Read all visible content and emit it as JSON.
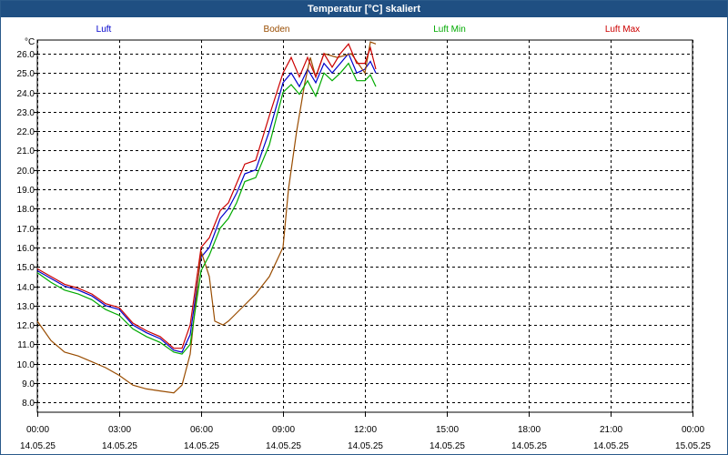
{
  "window": {
    "title": "Temperatur [°C] skaliert"
  },
  "chart_data": {
    "type": "line",
    "title": "Temperatur [°C] skaliert",
    "ylabel": "°C",
    "ylim": [
      8.0,
      26.0
    ],
    "y_ticks": [
      "8.0",
      "9.0",
      "10.0",
      "11.0",
      "12.0",
      "13.0",
      "14.0",
      "15.0",
      "16.0",
      "17.0",
      "18.0",
      "19.0",
      "20.0",
      "21.0",
      "22.0",
      "23.0",
      "24.0",
      "25.0",
      "26.0"
    ],
    "x_ticks": [
      {
        "time": "00:00",
        "date": "14.05.25"
      },
      {
        "time": "03:00",
        "date": "14.05.25"
      },
      {
        "time": "06:00",
        "date": "14.05.25"
      },
      {
        "time": "09:00",
        "date": "14.05.25"
      },
      {
        "time": "12:00",
        "date": "14.05.25"
      },
      {
        "time": "15:00",
        "date": "14.05.25"
      },
      {
        "time": "18:00",
        "date": "14.05.25"
      },
      {
        "time": "21:00",
        "date": "14.05.25"
      },
      {
        "time": "00:00",
        "date": "15.05.25"
      }
    ],
    "x_range_hours": [
      0,
      24
    ],
    "grid": true,
    "legend_position": "top",
    "series": [
      {
        "name": "Luft",
        "color": "#0000cc",
        "points": [
          [
            0,
            14.8
          ],
          [
            0.5,
            14.4
          ],
          [
            1,
            14.0
          ],
          [
            1.5,
            13.8
          ],
          [
            2,
            13.5
          ],
          [
            2.5,
            13.0
          ],
          [
            3,
            12.8
          ],
          [
            3.5,
            12.0
          ],
          [
            4,
            11.6
          ],
          [
            4.5,
            11.3
          ],
          [
            5,
            10.7
          ],
          [
            5.3,
            10.6
          ],
          [
            5.6,
            11.5
          ],
          [
            6,
            15.5
          ],
          [
            6.3,
            16.0
          ],
          [
            6.7,
            17.5
          ],
          [
            7,
            18.0
          ],
          [
            7.3,
            18.8
          ],
          [
            7.6,
            19.8
          ],
          [
            8,
            20.0
          ],
          [
            8.5,
            22.0
          ],
          [
            9,
            24.5
          ],
          [
            9.3,
            25.0
          ],
          [
            9.6,
            24.3
          ],
          [
            9.9,
            25.2
          ],
          [
            10.2,
            24.5
          ],
          [
            10.5,
            25.5
          ],
          [
            10.8,
            25.0
          ],
          [
            11.1,
            25.5
          ],
          [
            11.4,
            26.0
          ],
          [
            11.7,
            25.0
          ],
          [
            12,
            25.2
          ],
          [
            12.2,
            25.6
          ],
          [
            12.4,
            25.0
          ]
        ]
      },
      {
        "name": "Boden",
        "color": "#994c00",
        "points": [
          [
            0,
            12.2
          ],
          [
            0.5,
            11.2
          ],
          [
            1,
            10.6
          ],
          [
            1.5,
            10.4
          ],
          [
            2,
            10.1
          ],
          [
            2.5,
            9.8
          ],
          [
            3,
            9.4
          ],
          [
            3.5,
            8.9
          ],
          [
            4,
            8.7
          ],
          [
            4.5,
            8.6
          ],
          [
            5,
            8.5
          ],
          [
            5.3,
            8.9
          ],
          [
            5.6,
            10.5
          ],
          [
            6,
            15.8
          ],
          [
            6.3,
            14.5
          ],
          [
            6.5,
            12.2
          ],
          [
            6.8,
            12.0
          ],
          [
            7,
            12.2
          ],
          [
            7.5,
            12.9
          ],
          [
            8,
            13.6
          ],
          [
            8.5,
            14.5
          ],
          [
            9,
            16.0
          ],
          [
            9.2,
            19.0
          ],
          [
            9.5,
            22.0
          ],
          [
            9.8,
            24.5
          ],
          [
            10,
            25.8
          ],
          [
            10.2,
            24.8
          ],
          [
            10.5,
            26.0
          ],
          [
            11,
            25.8
          ],
          [
            11.5,
            26.0
          ],
          [
            12,
            25.0
          ],
          [
            12.2,
            26.6
          ],
          [
            12.4,
            26.5
          ]
        ]
      },
      {
        "name": "Luft Min",
        "color": "#00aa00",
        "points": [
          [
            0,
            14.7
          ],
          [
            0.5,
            14.2
          ],
          [
            1,
            13.8
          ],
          [
            1.5,
            13.6
          ],
          [
            2,
            13.3
          ],
          [
            2.5,
            12.8
          ],
          [
            3,
            12.5
          ],
          [
            3.5,
            11.8
          ],
          [
            4,
            11.4
          ],
          [
            4.5,
            11.1
          ],
          [
            5,
            10.6
          ],
          [
            5.3,
            10.5
          ],
          [
            5.6,
            11.0
          ],
          [
            6,
            14.8
          ],
          [
            6.3,
            15.6
          ],
          [
            6.7,
            17.0
          ],
          [
            7,
            17.5
          ],
          [
            7.3,
            18.3
          ],
          [
            7.6,
            19.4
          ],
          [
            8,
            19.6
          ],
          [
            8.5,
            21.3
          ],
          [
            9,
            24.0
          ],
          [
            9.3,
            24.4
          ],
          [
            9.6,
            23.9
          ],
          [
            9.9,
            24.6
          ],
          [
            10.2,
            23.8
          ],
          [
            10.5,
            25.0
          ],
          [
            10.8,
            24.6
          ],
          [
            11.1,
            25.0
          ],
          [
            11.4,
            25.5
          ],
          [
            11.7,
            24.6
          ],
          [
            12,
            24.6
          ],
          [
            12.2,
            24.9
          ],
          [
            12.4,
            24.3
          ]
        ]
      },
      {
        "name": "Luft Max",
        "color": "#cc0000",
        "points": [
          [
            0,
            14.9
          ],
          [
            0.5,
            14.5
          ],
          [
            1,
            14.1
          ],
          [
            1.5,
            13.9
          ],
          [
            2,
            13.6
          ],
          [
            2.5,
            13.1
          ],
          [
            3,
            12.9
          ],
          [
            3.5,
            12.1
          ],
          [
            4,
            11.7
          ],
          [
            4.5,
            11.4
          ],
          [
            5,
            10.8
          ],
          [
            5.3,
            10.8
          ],
          [
            5.6,
            12.0
          ],
          [
            6,
            16.0
          ],
          [
            6.3,
            16.5
          ],
          [
            6.7,
            17.9
          ],
          [
            7,
            18.3
          ],
          [
            7.3,
            19.3
          ],
          [
            7.6,
            20.3
          ],
          [
            8,
            20.5
          ],
          [
            8.5,
            22.8
          ],
          [
            9,
            25.0
          ],
          [
            9.3,
            25.8
          ],
          [
            9.6,
            24.8
          ],
          [
            9.9,
            25.8
          ],
          [
            10.2,
            24.8
          ],
          [
            10.5,
            26.0
          ],
          [
            10.8,
            25.3
          ],
          [
            11.1,
            26.0
          ],
          [
            11.4,
            26.5
          ],
          [
            11.7,
            25.5
          ],
          [
            12,
            25.5
          ],
          [
            12.2,
            26.3
          ],
          [
            12.4,
            25.2
          ]
        ]
      }
    ]
  }
}
